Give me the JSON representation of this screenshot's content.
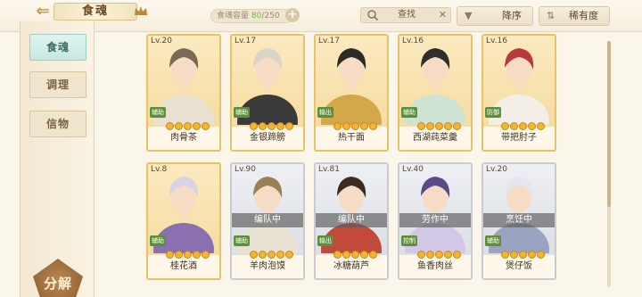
{
  "header": {
    "title": "食魂",
    "capacity_label": "食魂容量",
    "capacity_current": "80",
    "capacity_max": "/250",
    "plus_label": "+",
    "search_placeholder": "查找",
    "clear_label": "✕",
    "sort_order_label": "降序",
    "sort_field_label": "稀有度"
  },
  "sidebar": {
    "tabs": [
      {
        "label": "食魂",
        "active": true
      },
      {
        "label": "调理",
        "active": false
      },
      {
        "label": "信物",
        "active": false
      }
    ],
    "decompose_label": "分解"
  },
  "cards": [
    {
      "level": "Lv.20",
      "name": "肉骨茶",
      "tag": "辅助",
      "stars": 5,
      "frame": "gold",
      "busy": ""
    },
    {
      "level": "Lv.17",
      "name": "金银蹄膀",
      "tag": "辅助",
      "stars": 5,
      "frame": "gold",
      "busy": ""
    },
    {
      "level": "Lv.17",
      "name": "热干面",
      "tag": "输出",
      "stars": 5,
      "frame": "gold",
      "busy": ""
    },
    {
      "level": "Lv.16",
      "name": "西湖莼菜羹",
      "tag": "辅助",
      "stars": 5,
      "frame": "gold",
      "busy": ""
    },
    {
      "level": "Lv.16",
      "name": "带把肘子",
      "tag": "防御",
      "stars": 5,
      "frame": "gold",
      "busy": ""
    },
    {
      "level": "Lv.8",
      "name": "桂花酒",
      "tag": "辅助",
      "stars": 5,
      "frame": "gold",
      "busy": ""
    },
    {
      "level": "Lv.90",
      "name": "羊肉泡馍",
      "tag": "辅助",
      "stars": 5,
      "frame": "silver",
      "busy": "编队中"
    },
    {
      "level": "Lv.81",
      "name": "冰糖葫芦",
      "tag": "输出",
      "stars": 5,
      "frame": "silver",
      "busy": "编队中"
    },
    {
      "level": "Lv.40",
      "name": "鱼香肉丝",
      "tag": "控制",
      "stars": 5,
      "frame": "silver",
      "busy": "劳作中"
    },
    {
      "level": "Lv.20",
      "name": "煲仔饭",
      "tag": "辅助",
      "stars": 5,
      "frame": "silver",
      "busy": "烹饪中"
    }
  ],
  "colors": {
    "accent_gold": "#e8c16a",
    "accent_green": "#7cb342",
    "active_tab": "#c7e8e2"
  }
}
